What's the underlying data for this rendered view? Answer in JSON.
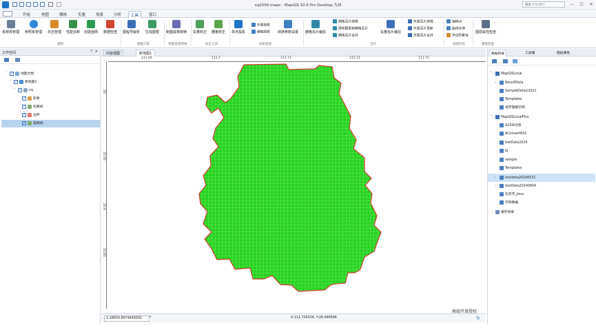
{
  "titlebar": {
    "title": "xq2000.mapx - MapGIS 10.6 Pro Desktop 九州",
    "search_placeholder": "搜索 [Ctrl][F]",
    "min": "—",
    "max": "☐",
    "close": "✕"
  },
  "menubar": {
    "tabs": [
      "开始",
      "地图",
      "栅格",
      "矢量",
      "场景",
      "分析",
      "工具",
      "窗口"
    ],
    "active_tab": "工具"
  },
  "ribbon": {
    "buttons": [
      {
        "label": "系统库管理",
        "icon": "database-gear-icon",
        "color": "#6a7f99"
      },
      {
        "label": "参照系管理",
        "icon": "globe-icon",
        "color": "#2e86d6"
      },
      {
        "label": "日志管理",
        "icon": "log-icon",
        "color": "#d88b2a"
      },
      {
        "label": "性能诊断",
        "icon": "performance-icon",
        "color": "#3a8f4a"
      },
      {
        "label": "创建渔网",
        "icon": "fishnet-icon",
        "color": "#2a9b4f"
      },
      {
        "label": "数据检查",
        "icon": "check-icon",
        "color": "#d0432f"
      },
      {
        "label": "图幅号解析",
        "icon": "sheet-number-icon",
        "color": "#3a6fb5"
      },
      {
        "label": "生成图框",
        "icon": "map-frame-icon",
        "color": "#3b9d63"
      },
      {
        "label": "制图成果转换",
        "icon": "convert-icon",
        "color": "#6b6bb3"
      },
      {
        "label": "矢量校正",
        "icon": "vector-correct-icon",
        "color": "#4fa05a"
      },
      {
        "label": "栅格校正",
        "icon": "raster-correct-icon",
        "color": "#5ba74d"
      },
      {
        "label": "单点投影",
        "icon": "point-projection-icon",
        "color": "#1e74c8"
      },
      {
        "label": "转换参数设置",
        "icon": "parameter-settings-icon",
        "color": "#3c7fc2"
      },
      {
        "label": "栅格瓦片裁剪",
        "icon": "raster-tile-clip-icon",
        "color": "#2e89a8"
      },
      {
        "label": "矢量瓦片裁剪",
        "icon": "vector-tile-clip-icon",
        "color": "#3c6fb8"
      },
      {
        "label": "图层属性检查",
        "icon": "layer-attribute-check-icon",
        "color": "#5b6f88"
      }
    ],
    "small_buttons": {
      "projection": [
        "矢量投影",
        "栅格投影"
      ],
      "tiles": [
        "栅格瓦片续裁",
        "用地图更新栅格瓦片",
        "栅格瓦片合并"
      ],
      "vector_tiles": [
        "矢量瓦片续裁",
        "矢量瓦片更新",
        "矢量瓦片合并"
      ],
      "map_synthesis": [
        "抽稀点",
        "曲线化简",
        "多边形聚合"
      ]
    },
    "groups": [
      "通用",
      "图幅工具",
      "制图成果转换",
      "校正工具",
      "投影变换",
      "瓦片",
      "地图综合",
      "属性检查"
    ]
  },
  "left_panel": {
    "title": "工作空间",
    "tree": [
      {
        "label": "地图文档",
        "level": 0,
        "icon": "map-document-icon"
      },
      {
        "label": "新地图1",
        "level": 1,
        "icon": "map-icon"
      },
      {
        "label": "xq",
        "level": 2,
        "icon": "layer-group-icon"
      },
      {
        "label": "影像",
        "level": 3,
        "icon": "image-layer-icon"
      },
      {
        "label": "轮廓线",
        "level": 3,
        "icon": "line-layer-icon"
      },
      {
        "label": "边界",
        "level": 3,
        "icon": "polygon-layer-icon"
      },
      {
        "label": "渔网线",
        "level": 3,
        "icon": "line-layer-icon",
        "selected": true
      }
    ]
  },
  "doc_tabs": [
    {
      "label": "内容视图",
      "active": false
    },
    {
      "label": "新地图1",
      "active": true
    }
  ],
  "ruler": {
    "h_labels": [
      "111.69",
      "111.7",
      "111.71",
      "111.72",
      "111.73"
    ],
    "v_labels": [
      "26",
      "25.95",
      "25.9",
      "25.85"
    ]
  },
  "map": {
    "fill_color": "#27d320",
    "grid_color": "#9ff59a",
    "border_color": "#d23a2a"
  },
  "watermark": "高级开发授权",
  "statusbar": {
    "scale": "1:18054.8974449501",
    "dropdown": "▾",
    "coords": "X:111.726316, Y:26.046584"
  },
  "right_panel": {
    "tabs": [
      "数据目录",
      "工具箱",
      "图层属性"
    ],
    "active_tab": "数据目录",
    "tree": [
      {
        "label": "MapGISLocal",
        "level": 0,
        "expand": "˅",
        "icon": "server-icon"
      },
      {
        "label": "ResultData",
        "level": 1,
        "expand": "›",
        "icon": "database-icon"
      },
      {
        "label": "SampleDataLi2021",
        "level": 1,
        "expand": "",
        "icon": "database-icon"
      },
      {
        "label": "Templates",
        "level": 1,
        "expand": "",
        "icon": "database-icon"
      },
      {
        "label": "地学建模示例",
        "level": 1,
        "expand": "",
        "icon": "database-icon"
      },
      {
        "label": "MapGISLocalPlus",
        "level": 0,
        "expand": "˅",
        "icon": "server-icon"
      },
      {
        "label": "A2SW迁移",
        "level": 1,
        "expand": "",
        "icon": "database-icon"
      },
      {
        "label": "AConvertR01",
        "level": 1,
        "expand": "",
        "icon": "database-icon"
      },
      {
        "label": "bakData2024",
        "level": 1,
        "expand": "",
        "icon": "database-icon"
      },
      {
        "label": "bj",
        "level": 1,
        "expand": "",
        "icon": "database-icon"
      },
      {
        "label": "sample",
        "level": 1,
        "expand": "",
        "icon": "database-icon"
      },
      {
        "label": "Templates",
        "level": 1,
        "expand": "",
        "icon": "database-icon"
      },
      {
        "label": "testdata20240531",
        "level": 1,
        "expand": "›",
        "icon": "database-icon",
        "selected": true
      },
      {
        "label": "testData20240604",
        "level": 1,
        "expand": "›",
        "icon": "database-icon"
      },
      {
        "label": "北京市_Java",
        "level": 1,
        "expand": "",
        "icon": "database-icon"
      },
      {
        "label": "示例数据",
        "level": 1,
        "expand": "",
        "icon": "database-icon"
      },
      {
        "label": "缓存目录",
        "level": 0,
        "expand": "›",
        "icon": "cache-folder-icon"
      }
    ]
  }
}
